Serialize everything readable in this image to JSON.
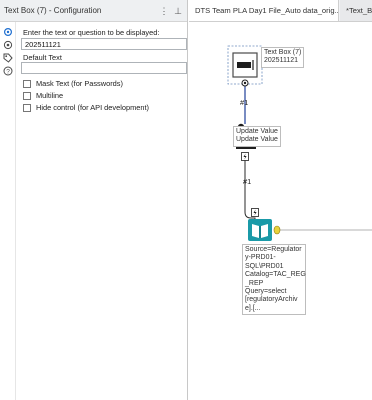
{
  "panel": {
    "title": "Text Box (7)  - Configuration",
    "more_label": "⋮",
    "pin_label": "⊥"
  },
  "form": {
    "prompt_label": "Enter the text or question to be displayed:",
    "prompt_value": "202511121",
    "default_label": "Default Text",
    "default_value": "",
    "mask_label": "Mask Text (for Passwords)",
    "multiline_label": "Multiline",
    "hide_label": "Hide control (for API development)"
  },
  "tabs": [
    {
      "label": "DTS Team PLA Day1 File_Auto data_orig..."
    },
    {
      "label": "*Text_Bo"
    }
  ],
  "workflow": {
    "textbox_label": "Text Box (7)\n202511121",
    "update_label": "Update Value\nUpdate Value",
    "conn1_label": "#1",
    "conn2_label": "#1",
    "input_label": "Source=Regulator\ny-PRD01-\nSQL\\PRD01\nCatalog=TAC_REG\n_REP\nQuery=select\n[regulatoryArchiv\ne].[..."
  },
  "icons": {
    "rail": [
      "gear-icon",
      "target-icon",
      "tag-icon",
      "help-icon"
    ],
    "textbox_tool": "textbox-tool-icon",
    "action_tool": "action-tool-icon",
    "input_tool": "input-data-tool-icon"
  },
  "colors": {
    "accent_blue": "#1f6fd0",
    "connector": "#2a2a2a",
    "input_tool_teal": "#1a9aa8",
    "anchor_yellow": "#e9d33b"
  }
}
